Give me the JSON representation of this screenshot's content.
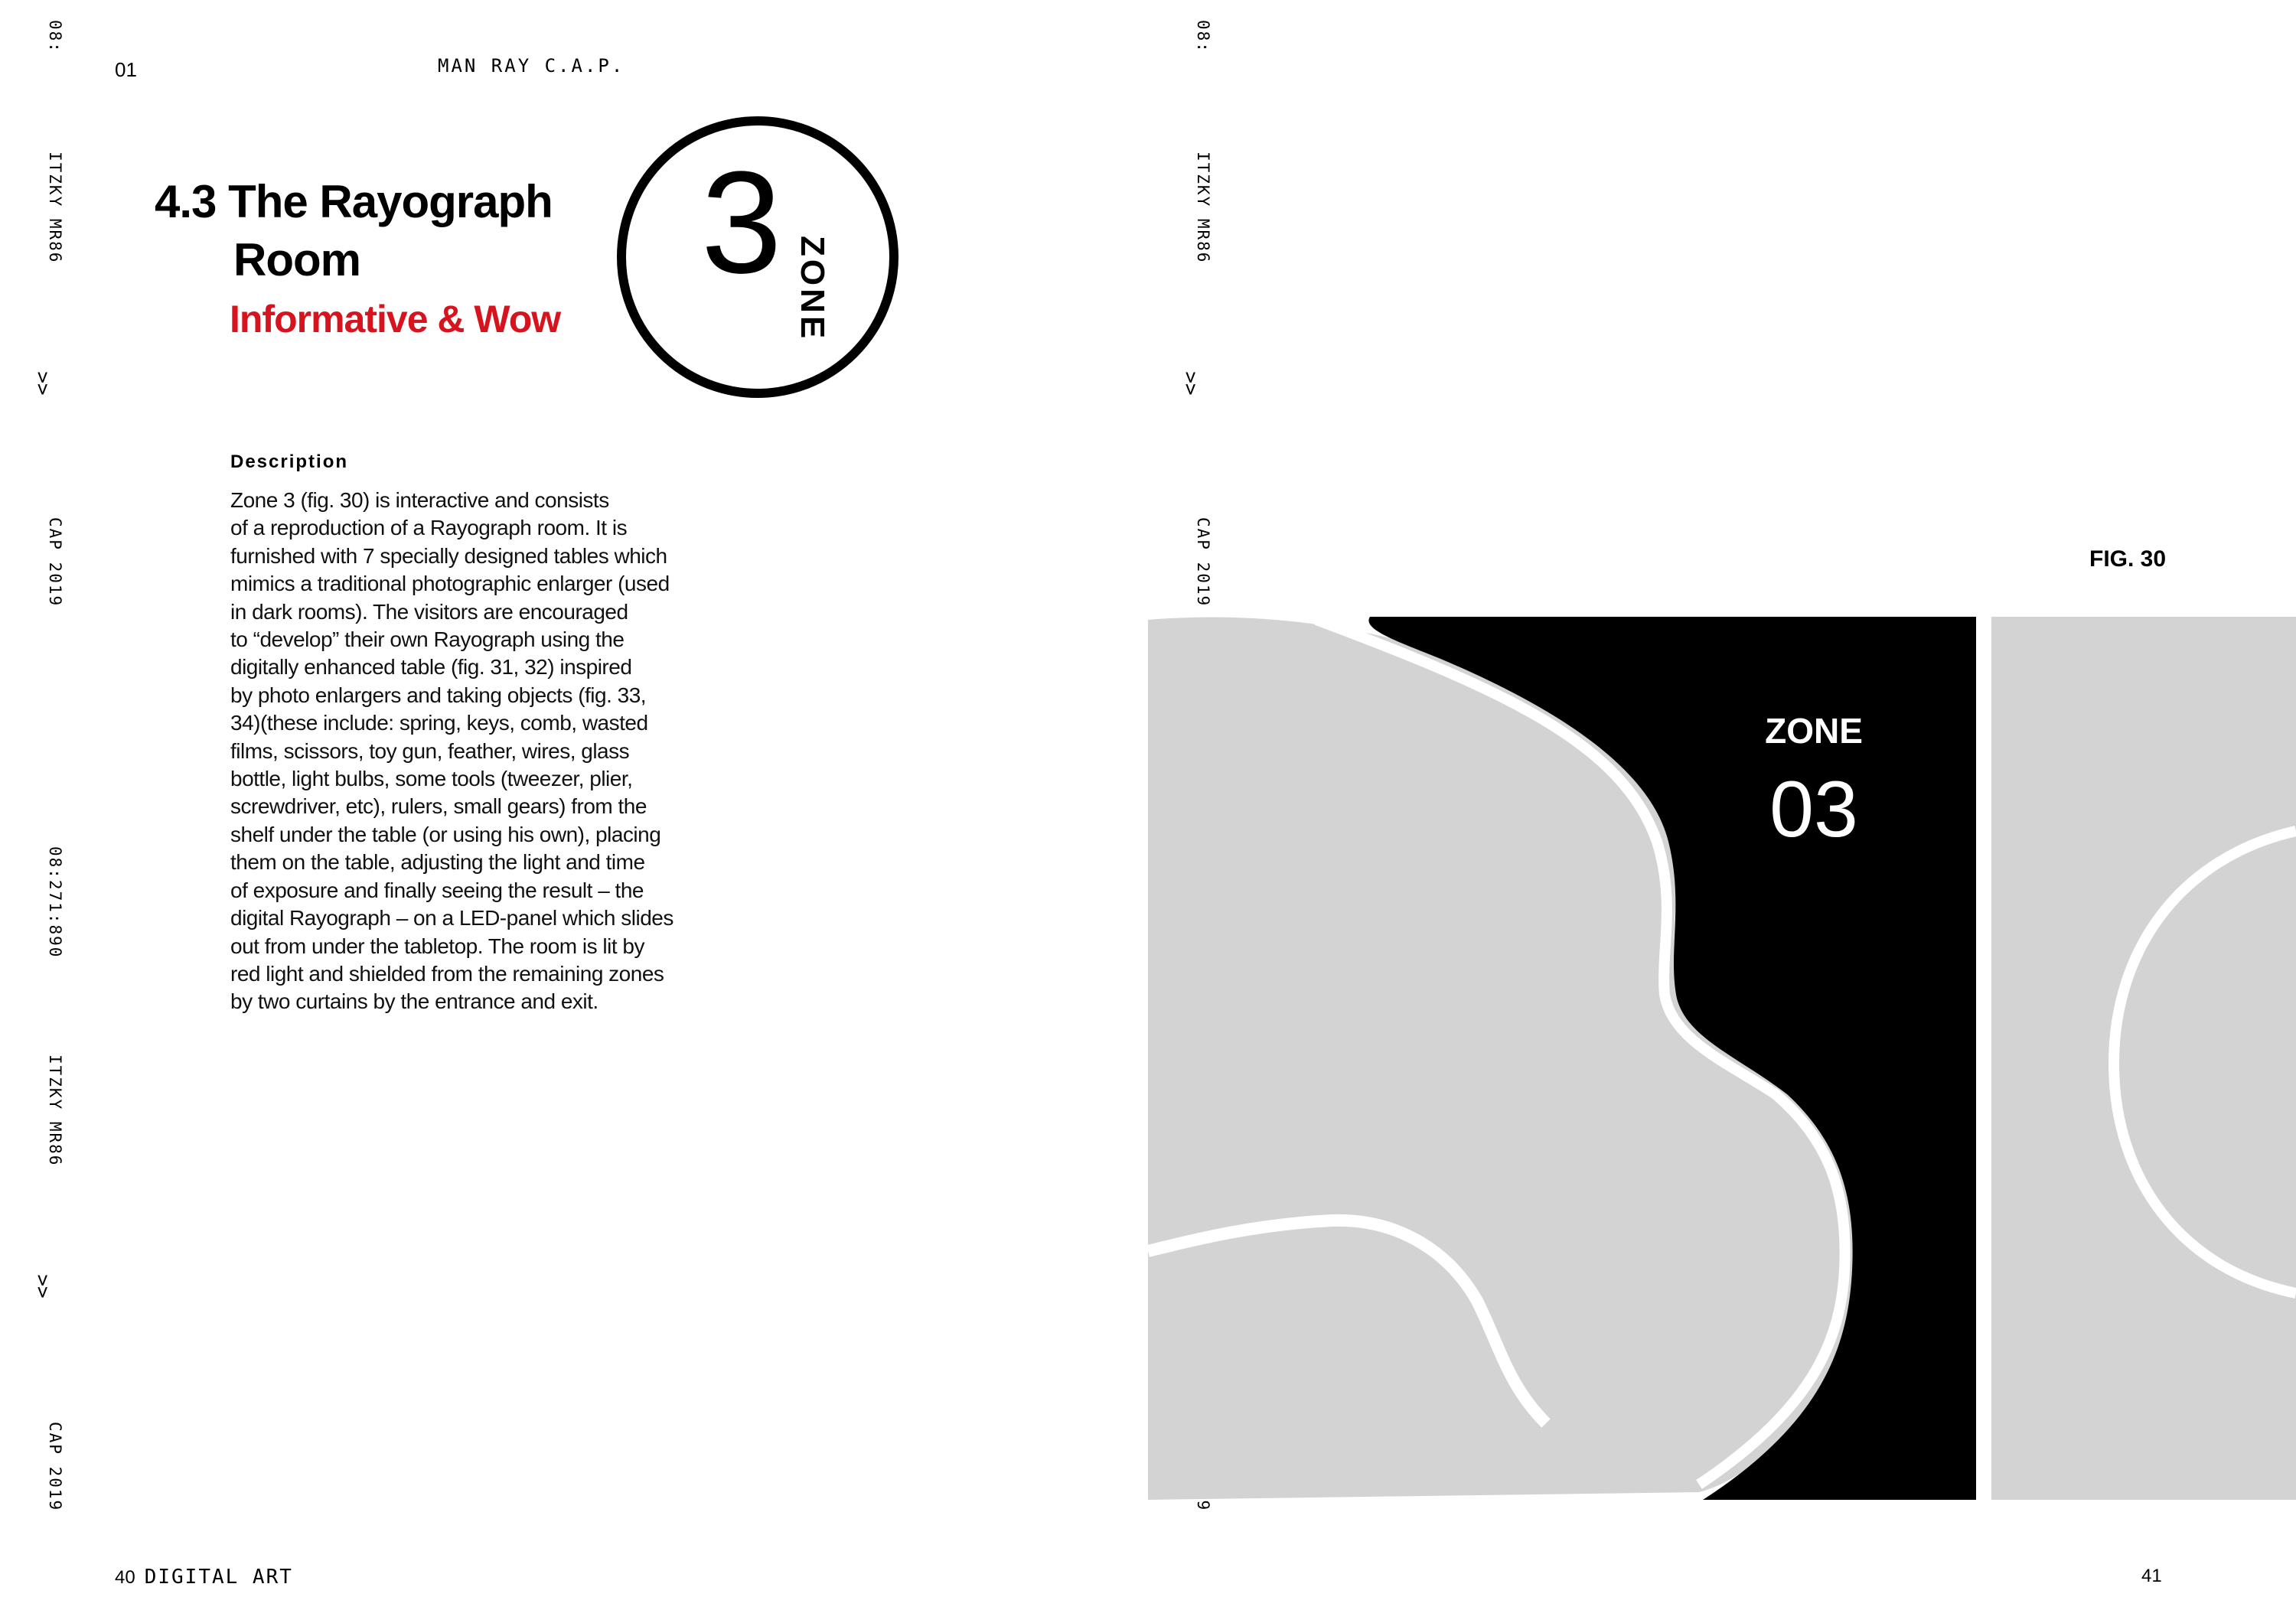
{
  "margin_strip": {
    "time_top": "08:",
    "code_a": "ITZKY MR86",
    "arrows": ">>",
    "year": "CAP 2019",
    "time_full": "08:271:890"
  },
  "header": {
    "page_index": "01",
    "publication": "MAN RAY C.A.P."
  },
  "section": {
    "heading_line1": "4.3 The Rayograph",
    "heading_line2": "Room",
    "subheading": "Informative & Wow",
    "zone_number": "3",
    "zone_word": "ZONE"
  },
  "description": {
    "label": "Description",
    "lines": [
      "Zone 3 (fig. 30) is interactive and consists",
      "of a reproduction of a Rayograph room. It is",
      "furnished with 7 specially designed tables which",
      "mimics a traditional photographic enlarger (used",
      "in dark rooms). The visitors are encouraged",
      "to “develop” their own Rayograph using the",
      "digitally enhanced table (fig. 31, 32) inspired",
      "by photo enlargers and taking objects (fig. 33,",
      "34)(these include: spring, keys, comb, wasted",
      "films, scissors, toy gun, feather, wires, glass",
      "bottle, light bulbs, some tools (tweezer, plier,",
      "screwdriver, etc), rulers, small gears) from the",
      "shelf under the table (or using his own), placing",
      "them on the table, adjusting the light and time",
      "of exposure and finally seeing the result – the",
      "digital Rayograph – on a LED-panel which slides",
      "out from under the tabletop. The room is lit by",
      "red light and shielded from the remaining zones",
      "by two curtains by the entrance and exit."
    ]
  },
  "figure": {
    "label": "FIG. 30",
    "zone_label": "ZONE",
    "zone_code": "03"
  },
  "footer": {
    "left_page": "40",
    "left_section": "DIGITAL ART",
    "right_page": "41"
  },
  "colors": {
    "accent_red": "#d7141e",
    "floor_gray": "#d3d3d3",
    "zone_black": "#000000"
  }
}
